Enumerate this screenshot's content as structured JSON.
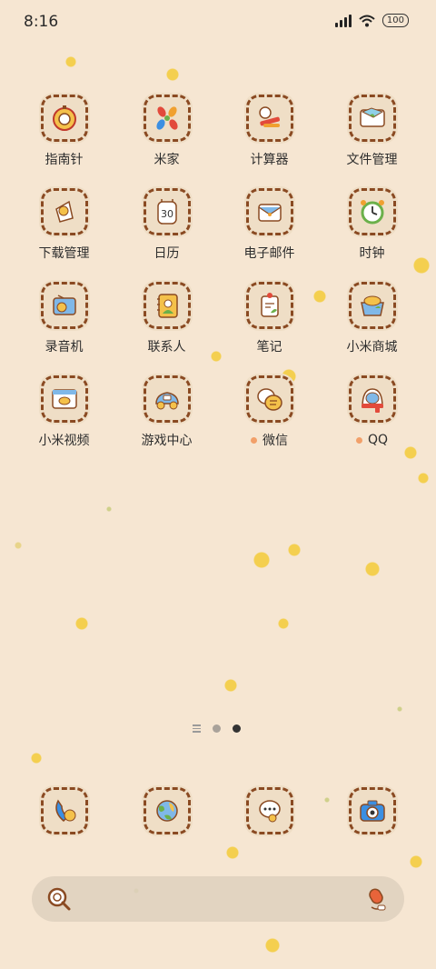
{
  "status_bar": {
    "time": "8:16",
    "battery": "100",
    "icons": [
      "signal-icon",
      "wifi-icon",
      "battery-icon"
    ]
  },
  "apps": [
    {
      "label": "指南针",
      "icon": "compass-icon"
    },
    {
      "label": "米家",
      "icon": "mi-home-icon"
    },
    {
      "label": "计算器",
      "icon": "calculator-icon"
    },
    {
      "label": "文件管理",
      "icon": "folder-icon"
    },
    {
      "label": "下载管理",
      "icon": "download-icon"
    },
    {
      "label": "日历",
      "icon": "calendar-icon",
      "day": "30"
    },
    {
      "label": "电子邮件",
      "icon": "email-icon"
    },
    {
      "label": "时钟",
      "icon": "clock-icon"
    },
    {
      "label": "录音机",
      "icon": "recorder-icon"
    },
    {
      "label": "联系人",
      "icon": "contacts-icon"
    },
    {
      "label": "笔记",
      "icon": "notes-icon"
    },
    {
      "label": "小米商城",
      "icon": "mi-store-icon"
    },
    {
      "label": "小米视频",
      "icon": "mi-video-icon"
    },
    {
      "label": "游戏中心",
      "icon": "game-center-icon"
    },
    {
      "label": "微信",
      "icon": "wechat-icon",
      "new_indicator": true
    },
    {
      "label": "QQ",
      "icon": "qq-icon",
      "new_indicator": true
    }
  ],
  "page_indicator": {
    "pages": 2,
    "active": 2
  },
  "dock": [
    {
      "icon": "phone-icon"
    },
    {
      "icon": "browser-icon"
    },
    {
      "icon": "messages-icon"
    },
    {
      "icon": "camera-icon"
    }
  ],
  "search": {
    "placeholder": "",
    "value": ""
  },
  "colors": {
    "background": "#f6e6d2",
    "tile_border": "#8a4a22",
    "tile_fill": "#efdec6",
    "notification_dot": "#f2a06a",
    "confetti": "#f4cf4f"
  }
}
